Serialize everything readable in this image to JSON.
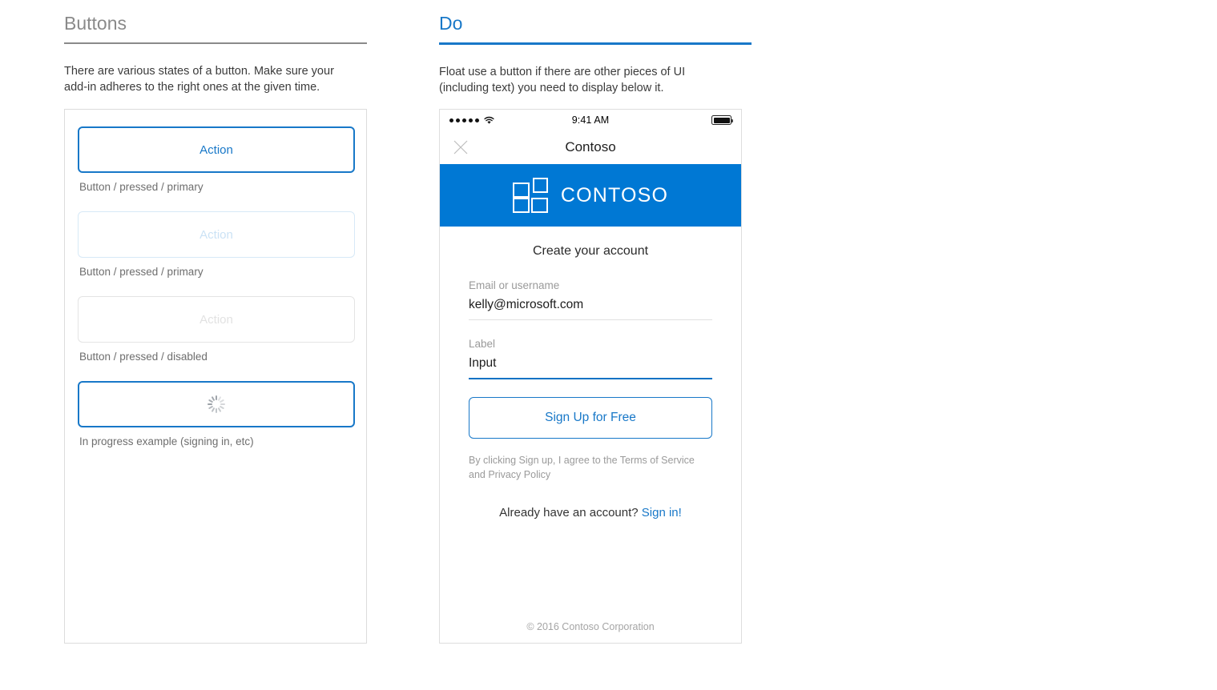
{
  "left": {
    "heading": "Buttons",
    "description": "There are various states of a button. Make sure your add-in adheres to the right ones at the given time.",
    "buttons": [
      {
        "label": "Action",
        "caption": "Button / pressed / primary",
        "state": "primary"
      },
      {
        "label": "Action",
        "caption": "Button / pressed / primary",
        "state": "faded"
      },
      {
        "label": "Action",
        "caption": "Button / pressed / disabled",
        "state": "disabled"
      },
      {
        "label": "",
        "caption": "In progress example (signing in, etc)",
        "state": "progress"
      }
    ]
  },
  "right": {
    "heading": "Do",
    "description": "Float use a button if there are other pieces of UI (including text) you need to display below it.",
    "phone": {
      "status_bar": {
        "time": "9:41 AM",
        "signal_dots": 5,
        "wifi": "wifi-icon",
        "battery": "battery-full-icon"
      },
      "nav": {
        "close": "close-icon",
        "title": "Contoso"
      },
      "banner": {
        "logo": "contoso-grid-logo",
        "brand": "CONTOSO",
        "color": "#0078d4"
      },
      "form": {
        "title": "Create your account",
        "fields": [
          {
            "label": "Email or username",
            "value": "kelly@microsoft.com",
            "state": "rest"
          },
          {
            "label": "Label",
            "value": "Input",
            "state": "focus"
          }
        ],
        "submit_label": "Sign Up for Free",
        "terms": "By clicking Sign up, I agree to the Terms of Service and Privacy Policy",
        "signin_prompt": "Already have an account?",
        "signin_link": "Sign in!"
      },
      "footer": "© 2016 Contoso Corporation"
    }
  },
  "colors": {
    "accent_blue": "#1878c8",
    "banner_blue": "#0078d4",
    "heading_gray": "#8a8a8a",
    "caption_gray": "#6e6e6e",
    "muted_gray": "#9a9a9a"
  }
}
